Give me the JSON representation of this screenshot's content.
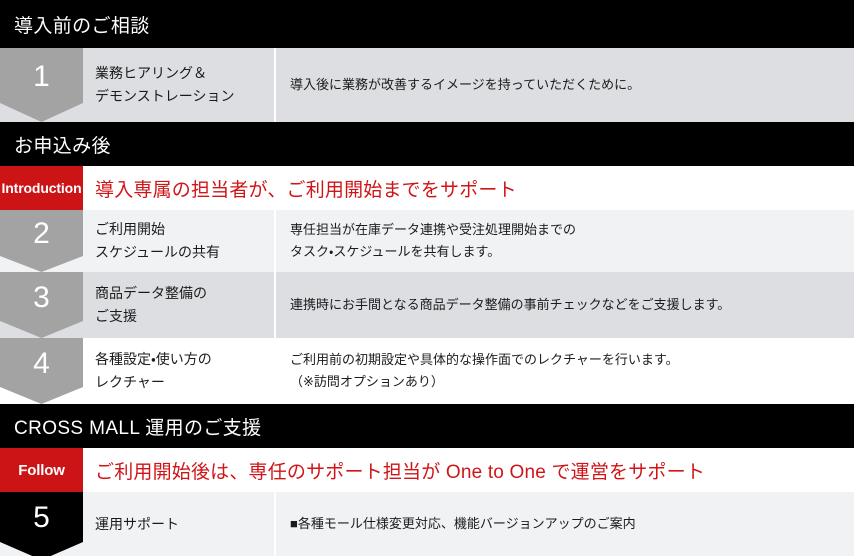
{
  "sections": [
    {
      "id": "pre-consultation",
      "header": "導入前のご相談",
      "banner": null,
      "steps": [
        {
          "number": "1",
          "marker_color": "#a3a3a3",
          "title_lines": [
            "業務ヒアリング＆",
            "デモンストレーション"
          ],
          "detail_lines": [
            "導入後に業務が改善するイメージを持っていただくために。"
          ],
          "row_bg": "#dcdee1"
        }
      ]
    },
    {
      "id": "after-application",
      "header": "お申込み後",
      "banner": {
        "badge": "Introduction",
        "text": "導入専属の担当者が、ご利用開始までをサポート",
        "badge_bg": "#cc1417",
        "text_color": "#d01518"
      },
      "steps": [
        {
          "number": "2",
          "marker_color": "#a3a3a3",
          "title_lines": [
            "ご利用開始",
            "スケジュールの共有"
          ],
          "detail_lines": [
            "専任担当が在庫データ連携や受注処理開始までの",
            "タスク・スケジュールを共有します。"
          ],
          "row_bg": "#f1f2f3"
        },
        {
          "number": "3",
          "marker_color": "#a3a3a3",
          "title_lines": [
            "商品データ整備の",
            "ご支援"
          ],
          "detail_lines": [
            "連携時にお手間となる商品データ整備の事前チェックなどをご支援します。"
          ],
          "row_bg": "#dcdee1"
        },
        {
          "number": "4",
          "marker_color": "#a3a3a3",
          "title_lines": [
            "各種設定・使い方の",
            "レクチャー"
          ],
          "detail_lines": [
            "ご利用前の初期設定や具体的な操作面でのレクチャーを行います。",
            "（※訪問オプションあり）"
          ],
          "row_bg": "#ffffff"
        }
      ]
    },
    {
      "id": "cross-mall-operation",
      "header": "CROSS MALL 運用のご支援",
      "banner": {
        "badge": "Follow",
        "text": "ご利用開始後は、専任のサポート担当が One to One で運営をサポート",
        "badge_bg": "#cc1417",
        "text_color": "#d01518"
      },
      "steps": [
        {
          "number": "5",
          "marker_color": "#000000",
          "title_lines": [
            "運用サポート"
          ],
          "detail_lines": [
            "■各種モール仕様変更対応、機能バージョンアップのご案内"
          ],
          "row_bg": "#f1f2f3"
        }
      ]
    }
  ]
}
